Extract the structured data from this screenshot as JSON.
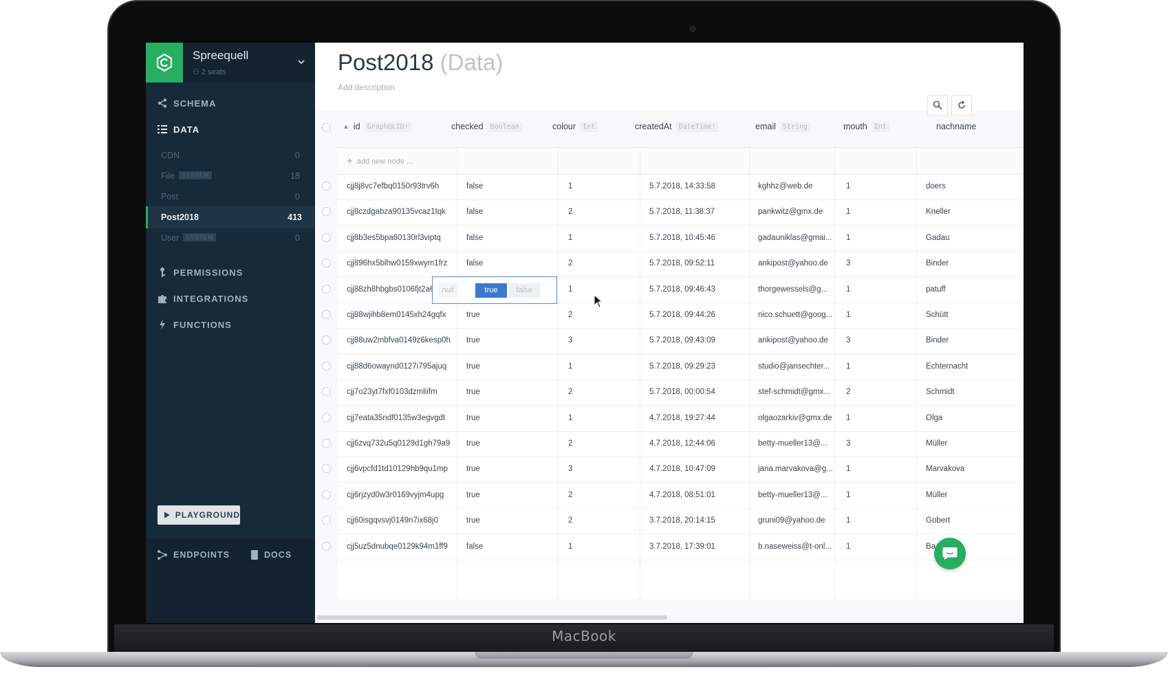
{
  "device": {
    "brand": "MacBook"
  },
  "project": {
    "name": "Spreequell",
    "seats": "2 seats"
  },
  "nav": {
    "schema": "SCHEMA",
    "data": "DATA",
    "permissions": "PERMISSIONS",
    "integrations": "INTEGRATIONS",
    "functions": "FUNCTIONS"
  },
  "models": [
    {
      "name": "CDN",
      "count": "0",
      "badge": ""
    },
    {
      "name": "File",
      "count": "18",
      "badge": "SYSTEM"
    },
    {
      "name": "Post",
      "count": "0",
      "badge": ""
    },
    {
      "name": "Post2018",
      "count": "413",
      "badge": ""
    },
    {
      "name": "User",
      "count": "0",
      "badge": "SYSTEM"
    }
  ],
  "playground": "PLAYGROUND",
  "footer": {
    "endpoints": "ENDPOINTS",
    "docs": "DOCS"
  },
  "page": {
    "title": "Post2018",
    "subtitle": "(Data)",
    "add_description": "Add description"
  },
  "columns": [
    {
      "name": "id",
      "type": "GraphQLID!"
    },
    {
      "name": "checked",
      "type": "Boolean"
    },
    {
      "name": "colour",
      "type": "Int"
    },
    {
      "name": "createdAt",
      "type": "DateTime!"
    },
    {
      "name": "email",
      "type": "String"
    },
    {
      "name": "mouth",
      "type": "Int"
    },
    {
      "name": "nachname",
      "type": ""
    }
  ],
  "add_node": "add new node ...",
  "rows": [
    [
      "cjj8j8vc7efbq0150r93trv6h",
      "false",
      "1",
      "5.7.2018, 14:33:58",
      "kghhz@web.de",
      "1",
      "doers"
    ],
    [
      "cjj8czdgabza90135vcaz1tqk",
      "false",
      "2",
      "5.7.2018, 11:38:37",
      "pankwitz@gmx.de",
      "1",
      "Kneller"
    ],
    [
      "cjj8b3es5bpa60130rl3viptq",
      "false",
      "1",
      "5.7.2018, 10:45:46",
      "gadauniklas@gmai...",
      "1",
      "Gadau"
    ],
    [
      "cjj896hx5blhw0159xwym1frz",
      "false",
      "2",
      "5.7.2018, 09:52:11",
      "ankipost@yahoo.de",
      "3",
      "Binder"
    ],
    [
      "cjj88zh8hbgbs0106fjt2a6ns",
      "",
      "1",
      "5.7.2018, 09:46:43",
      "thorgewessels@g...",
      "1",
      "patuff"
    ],
    [
      "cjj88wjihb8em0145xh24gqfx",
      "true",
      "2",
      "5.7.2018, 09:44:26",
      "nico.schuett@goog...",
      "1",
      "Schütt"
    ],
    [
      "cjj88uw2mbfva0149z6kesp0h",
      "true",
      "3",
      "5.7.2018, 09:43:09",
      "ankipost@yahoo.de",
      "3",
      "Binder"
    ],
    [
      "cjj88d6owaynd0127i795ajuq",
      "true",
      "1",
      "5.7.2018, 09:29:23",
      "studio@jansechter...",
      "1",
      "Echternacht"
    ],
    [
      "cjj7o23yt7fxf0103dzmliifm",
      "true",
      "2",
      "5.7.2018, 00:00:54",
      "stef-schmidt@gmx...",
      "2",
      "Schmidt"
    ],
    [
      "cjj7eata35ndf0135w3egvgdt",
      "true",
      "1",
      "4.7.2018, 19:27:44",
      "olgaozarkiv@gmx.de",
      "1",
      "Olga"
    ],
    [
      "cjj6zvq732u5q0129d1gh79a9",
      "true",
      "2",
      "4.7.2018, 12:44:06",
      "betty-mueller13@...",
      "3",
      "Müller"
    ],
    [
      "cjj6vpcfd1td10129hb9qu1mp",
      "true",
      "3",
      "4.7.2018, 10:47:09",
      "jana.marvakova@g...",
      "1",
      "Marvakova"
    ],
    [
      "cjj6rjzyd0w3r0169vyjm4upg",
      "true",
      "2",
      "4.7.2018, 08:51:01",
      "betty-mueller13@...",
      "1",
      "Müller"
    ],
    [
      "cjj60isgqvsvj0149n7ix68j0",
      "true",
      "2",
      "3.7.2018, 20:14:15",
      "gruni09@yahoo.de",
      "1",
      "Gobert"
    ],
    [
      "cjj5uz5dnubqe0129k94m1ff9",
      "false",
      "1",
      "3.7.2018, 17:39:01",
      "b.naseweiss@t-onl...",
      "1",
      "Ba"
    ]
  ],
  "editor": {
    "null": "null",
    "true": "true",
    "false": "false"
  },
  "colors": {
    "sidebar": "#172a3a",
    "accent": "#27ae60",
    "selected": "#3b79d1"
  }
}
